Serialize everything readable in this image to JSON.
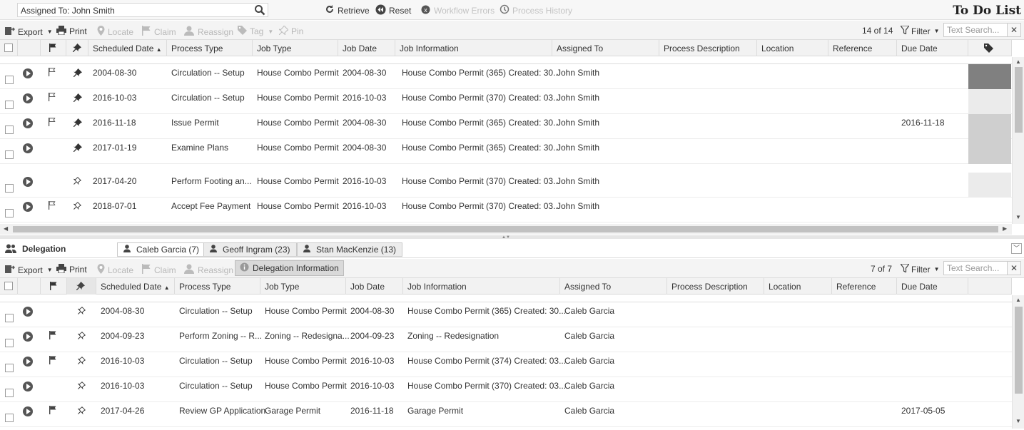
{
  "topbar": {
    "assigned_label": "Assigned To: John Smith",
    "retrieve": "Retrieve",
    "reset": "Reset",
    "workflow_errors": "Workflow Errors",
    "process_history": "Process History",
    "title": "To Do List"
  },
  "toolbar1": {
    "export": "Export",
    "print": "Print",
    "locate": "Locate",
    "claim": "Claim",
    "reassign": "Reassign",
    "tag": "Tag",
    "pin": "Pin",
    "count": "14 of 14",
    "filter": "Filter",
    "search_placeholder": "Text Search..."
  },
  "columns1": [
    "Scheduled Date",
    "Process Type",
    "Job Type",
    "Job Date",
    "Job Information",
    "Assigned To",
    "Process Description",
    "Location",
    "Reference",
    "Due Date"
  ],
  "rows1": [
    {
      "flag": true,
      "pin": "filled",
      "sched": "2004-08-30",
      "ptype": "Circulation -- Setup",
      "jtype": "House Combo Permit",
      "jdate": "2004-08-30",
      "jinfo": "House Combo Permit (365) Created: 30...",
      "assigned": "John Smith",
      "due": "",
      "color": "#808080"
    },
    {
      "flag": true,
      "pin": "filled",
      "sched": "2016-10-03",
      "ptype": "Circulation -- Setup",
      "jtype": "House Combo Permit",
      "jdate": "2016-10-03",
      "jinfo": "House Combo Permit (370) Created: 03...",
      "assigned": "John Smith",
      "due": "",
      "color": "#ebebeb"
    },
    {
      "flag": true,
      "pin": "filled",
      "sched": "2016-11-18",
      "ptype": "Issue Permit",
      "jtype": "House Combo Permit",
      "jdate": "2004-08-30",
      "jinfo": "House Combo Permit (365) Created: 30...",
      "assigned": "John Smith",
      "due": "2016-11-18",
      "color": "#cfcfcf"
    },
    {
      "flag": false,
      "pin": "filled",
      "sched": "2017-01-19",
      "ptype": "Examine Plans",
      "jtype": "House Combo Permit",
      "jdate": "2004-08-30",
      "jinfo": "House Combo Permit (365) Created: 30...",
      "assigned": "John Smith",
      "due": "",
      "color": "#cfcfcf"
    },
    {
      "flag": false,
      "pin": "outline",
      "sched": "2017-04-20",
      "ptype": "Perform Footing an...",
      "jtype": "House Combo Permit",
      "jdate": "2016-10-03",
      "jinfo": "House Combo Permit (370) Created: 03...",
      "assigned": "John Smith",
      "due": "",
      "color": "#ebebeb"
    },
    {
      "flag": true,
      "pin": "outline",
      "sched": "2018-07-01",
      "ptype": "Accept Fee Payment",
      "jtype": "House Combo Permit",
      "jdate": "2016-10-03",
      "jinfo": "House Combo Permit (370) Created: 03...",
      "assigned": "John Smith",
      "due": "",
      "color": ""
    }
  ],
  "delegation": {
    "title": "Delegation",
    "tabs": [
      "Caleb Garcia (7)",
      "Geoff Ingram (23)",
      "Stan MacKenzie (13)"
    ]
  },
  "toolbar2": {
    "export": "Export",
    "print": "Print",
    "locate": "Locate",
    "claim": "Claim",
    "reassign": "Reassign",
    "deleg_info": "Delegation Information",
    "count": "7 of 7",
    "filter": "Filter",
    "search_placeholder": "Text Search..."
  },
  "columns2": [
    "Scheduled Date",
    "Process Type",
    "Job Type",
    "Job Date",
    "Job Information",
    "Assigned To",
    "Process Description",
    "Location",
    "Reference",
    "Due Date"
  ],
  "rows2": [
    {
      "flag": false,
      "sched": "2004-08-30",
      "ptype": "Circulation -- Setup",
      "jtype": "House Combo Permit",
      "jdate": "2004-08-30",
      "jinfo": "House Combo Permit (365) Created: 30...",
      "assigned": "Caleb Garcia",
      "due": ""
    },
    {
      "flag": true,
      "sched": "2004-09-23",
      "ptype": "Perform Zoning -- R...",
      "jtype": "Zoning -- Redesigna...",
      "jdate": "2004-09-23",
      "jinfo": "Zoning -- Redesignation",
      "assigned": "Caleb Garcia",
      "due": ""
    },
    {
      "flag": true,
      "sched": "2016-10-03",
      "ptype": "Circulation -- Setup",
      "jtype": "House Combo Permit",
      "jdate": "2016-10-03",
      "jinfo": "House Combo Permit (374) Created: 03...",
      "assigned": "Caleb Garcia",
      "due": ""
    },
    {
      "flag": false,
      "sched": "2016-10-03",
      "ptype": "Circulation -- Setup",
      "jtype": "House Combo Permit",
      "jdate": "2016-10-03",
      "jinfo": "House Combo Permit (370) Created: 03...",
      "assigned": "Caleb Garcia",
      "due": ""
    },
    {
      "flag": true,
      "sched": "2017-04-26",
      "ptype": "Review GP Application",
      "jtype": "Garage Permit",
      "jdate": "2016-11-18",
      "jinfo": "Garage Permit",
      "assigned": "Caleb Garcia",
      "due": "2017-05-05"
    }
  ]
}
